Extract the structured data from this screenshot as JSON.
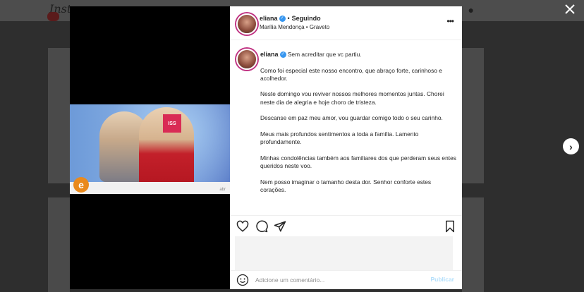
{
  "background": {
    "logo_text": "Instagram"
  },
  "modal": {
    "close_icon": "close-icon",
    "next_icon": "chevron-right-icon"
  },
  "media": {
    "sign_text": "ISS",
    "ticker_logo": "e",
    "ticker_text": "",
    "corner_text": "abr",
    "mute_icon": "speaker-muted-icon"
  },
  "post": {
    "header": {
      "username": "eliana",
      "follow_state": "Seguindo",
      "location": "Marília Mendonça • Graveto"
    },
    "caption": {
      "username": "eliana",
      "first_line": "Sem acreditar que vc partiu.",
      "paragraphs": [
        "Como foi especial este nosso encontro, que abraço forte, carinhoso e acolhedor.",
        "Neste domingo vou reviver nossos melhores momentos juntas. Chorei neste dia de alegria e hoje choro de tristeza.",
        "Descanse em paz meu amor, vou guardar comigo todo o seu carinho.",
        "Meus mais profundos sentimentos a toda a família. Lamento profundamente.",
        "Minhas condolências também aos familiares dos que perderam seus entes queridos neste voo.",
        "Nem posso imaginar o tamanho desta dor. Senhor conforte estes corações."
      ]
    },
    "actions": [
      "heart-icon",
      "comment-icon",
      "share-icon",
      "bookmark-icon"
    ],
    "comment_box": {
      "placeholder": "Adicione um comentário...",
      "publish_label": "Publicar"
    }
  }
}
